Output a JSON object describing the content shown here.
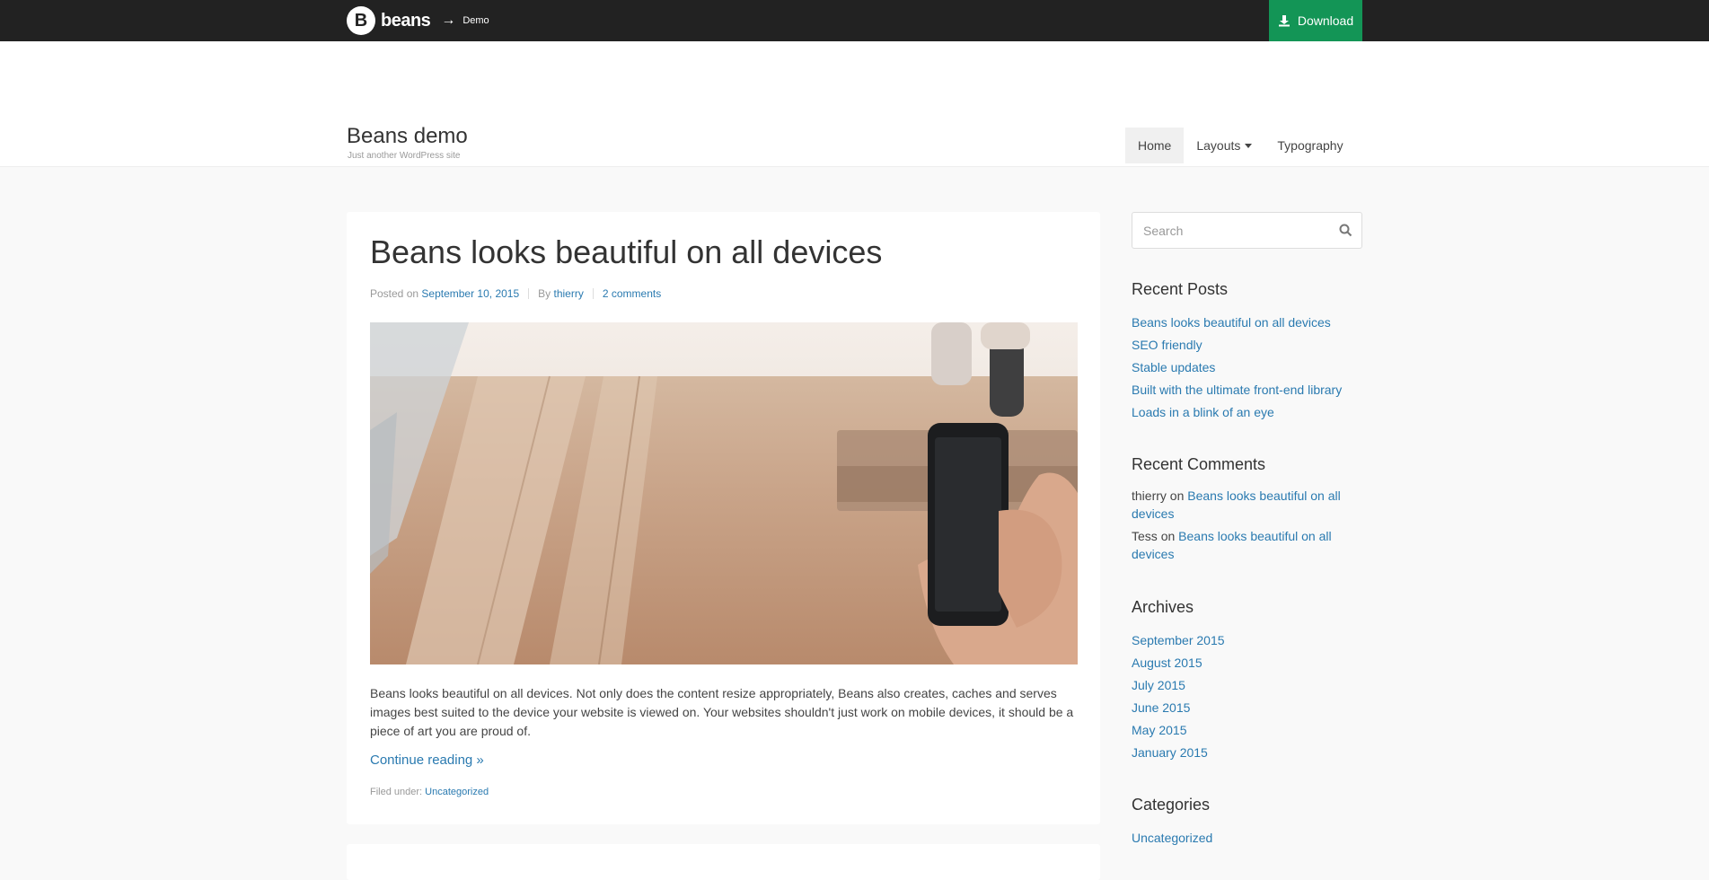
{
  "topbar": {
    "brand": "beans",
    "logo_letter": "B",
    "arrow": "→",
    "crumb": "Demo",
    "download_label": "Download",
    "download_color": "#139556"
  },
  "site": {
    "title": "Beans demo",
    "tagline": "Just another WordPress site"
  },
  "nav": {
    "home": "Home",
    "layouts": "Layouts",
    "typography": "Typography"
  },
  "post": {
    "title": "Beans looks beautiful on all devices",
    "posted_on_label": "Posted on",
    "date": "September 10, 2015",
    "by_label": "By",
    "author": "thierry",
    "comments": "2 comments",
    "excerpt": "Beans looks beautiful on all devices. Not only does the content resize appropriately, Beans also creates, caches and serves images best suited to the device your website is viewed on. Your websites shouldn't just work on mobile devices, it should be a piece of art you are proud of.",
    "continue_label": "Continue reading »",
    "filed_label": "Filed under:",
    "category": "Uncategorized"
  },
  "sidebar": {
    "search_placeholder": "Search",
    "recent_posts_title": "Recent Posts",
    "recent_posts": [
      "Beans looks beautiful on all devices",
      "SEO friendly",
      "Stable updates",
      "Built with the ultimate front-end library",
      "Loads in a blink of an eye"
    ],
    "recent_comments_title": "Recent Comments",
    "recent_comments": [
      {
        "author": "thierry",
        "on": "on",
        "post": "Beans looks beautiful on all devices"
      },
      {
        "author": "Tess",
        "on": "on",
        "post": "Beans looks beautiful on all devices"
      }
    ],
    "archives_title": "Archives",
    "archives": [
      "September 2015",
      "August 2015",
      "July 2015",
      "June 2015",
      "May 2015",
      "January 2015"
    ],
    "categories_title": "Categories",
    "categories": [
      "Uncategorized"
    ]
  }
}
